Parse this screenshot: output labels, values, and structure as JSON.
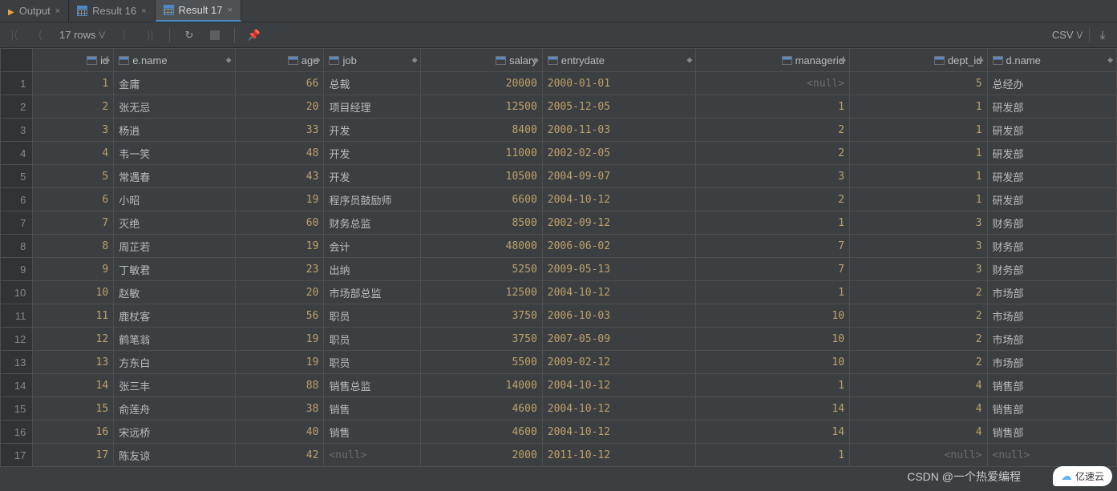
{
  "tabs": [
    {
      "label": "Output"
    },
    {
      "label": "Result 16"
    },
    {
      "label": "Result 17"
    }
  ],
  "toolbar": {
    "row_count": "17 rows",
    "export_format": "CSV"
  },
  "columns": {
    "id": "id",
    "ename": "e.name",
    "age": "age",
    "job": "job",
    "salary": "salary",
    "entrydate": "entrydate",
    "managerid": "managerid",
    "dept_id": "dept_id",
    "dname": "d.name"
  },
  "null_text": "<null>",
  "rows": [
    {
      "n": "1",
      "id": "1",
      "ename": "金庸",
      "age": "66",
      "job": "总裁",
      "salary": "20000",
      "entry": "2000-01-01",
      "mgr": null,
      "dept": "5",
      "dname": "总经办"
    },
    {
      "n": "2",
      "id": "2",
      "ename": "张无忌",
      "age": "20",
      "job": "项目经理",
      "salary": "12500",
      "entry": "2005-12-05",
      "mgr": "1",
      "dept": "1",
      "dname": "研发部"
    },
    {
      "n": "3",
      "id": "3",
      "ename": "杨逍",
      "age": "33",
      "job": "开发",
      "salary": "8400",
      "entry": "2000-11-03",
      "mgr": "2",
      "dept": "1",
      "dname": "研发部"
    },
    {
      "n": "4",
      "id": "4",
      "ename": "韦一笑",
      "age": "48",
      "job": "开发",
      "salary": "11000",
      "entry": "2002-02-05",
      "mgr": "2",
      "dept": "1",
      "dname": "研发部"
    },
    {
      "n": "5",
      "id": "5",
      "ename": "常遇春",
      "age": "43",
      "job": "开发",
      "salary": "10500",
      "entry": "2004-09-07",
      "mgr": "3",
      "dept": "1",
      "dname": "研发部"
    },
    {
      "n": "6",
      "id": "6",
      "ename": "小昭",
      "age": "19",
      "job": "程序员鼓励师",
      "salary": "6600",
      "entry": "2004-10-12",
      "mgr": "2",
      "dept": "1",
      "dname": "研发部"
    },
    {
      "n": "7",
      "id": "7",
      "ename": "灭绝",
      "age": "60",
      "job": "财务总监",
      "salary": "8500",
      "entry": "2002-09-12",
      "mgr": "1",
      "dept": "3",
      "dname": "财务部"
    },
    {
      "n": "8",
      "id": "8",
      "ename": "周芷若",
      "age": "19",
      "job": "会计",
      "salary": "48000",
      "entry": "2006-06-02",
      "mgr": "7",
      "dept": "3",
      "dname": "财务部"
    },
    {
      "n": "9",
      "id": "9",
      "ename": "丁敏君",
      "age": "23",
      "job": "出纳",
      "salary": "5250",
      "entry": "2009-05-13",
      "mgr": "7",
      "dept": "3",
      "dname": "财务部"
    },
    {
      "n": "10",
      "id": "10",
      "ename": "赵敏",
      "age": "20",
      "job": "市场部总监",
      "salary": "12500",
      "entry": "2004-10-12",
      "mgr": "1",
      "dept": "2",
      "dname": "市场部"
    },
    {
      "n": "11",
      "id": "11",
      "ename": "鹿杖客",
      "age": "56",
      "job": "职员",
      "salary": "3750",
      "entry": "2006-10-03",
      "mgr": "10",
      "dept": "2",
      "dname": "市场部"
    },
    {
      "n": "12",
      "id": "12",
      "ename": "鹤笔翁",
      "age": "19",
      "job": "职员",
      "salary": "3750",
      "entry": "2007-05-09",
      "mgr": "10",
      "dept": "2",
      "dname": "市场部"
    },
    {
      "n": "13",
      "id": "13",
      "ename": "方东白",
      "age": "19",
      "job": "职员",
      "salary": "5500",
      "entry": "2009-02-12",
      "mgr": "10",
      "dept": "2",
      "dname": "市场部"
    },
    {
      "n": "14",
      "id": "14",
      "ename": "张三丰",
      "age": "88",
      "job": "销售总监",
      "salary": "14000",
      "entry": "2004-10-12",
      "mgr": "1",
      "dept": "4",
      "dname": "销售部"
    },
    {
      "n": "15",
      "id": "15",
      "ename": "俞莲舟",
      "age": "38",
      "job": "销售",
      "salary": "4600",
      "entry": "2004-10-12",
      "mgr": "14",
      "dept": "4",
      "dname": "销售部"
    },
    {
      "n": "16",
      "id": "16",
      "ename": "宋远桥",
      "age": "40",
      "job": "销售",
      "salary": "4600",
      "entry": "2004-10-12",
      "mgr": "14",
      "dept": "4",
      "dname": "销售部"
    },
    {
      "n": "17",
      "id": "17",
      "ename": "陈友谅",
      "age": "42",
      "job": null,
      "salary": "2000",
      "entry": "2011-10-12",
      "mgr": "1",
      "dept": null,
      "dname": null
    }
  ],
  "footer": {
    "credit": "CSDN @一个热爱编程",
    "brand": "亿速云"
  }
}
